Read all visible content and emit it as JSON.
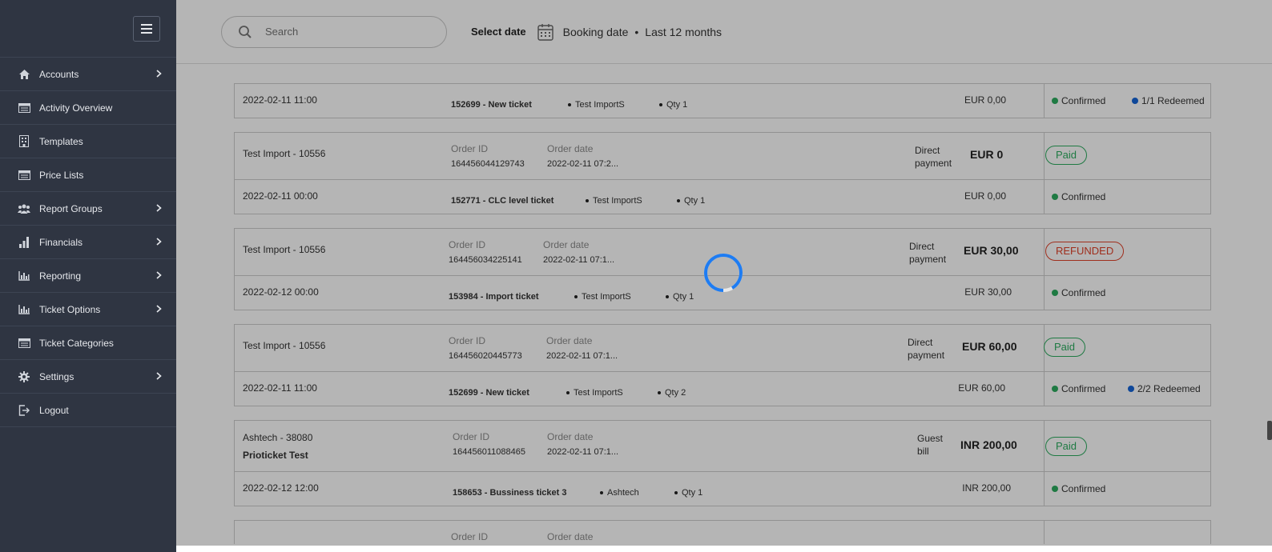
{
  "sidebar": {
    "items": [
      {
        "label": "Accounts",
        "icon": "home-icon",
        "has_submenu": true
      },
      {
        "label": "Activity Overview",
        "icon": "list-card-icon",
        "has_submenu": false
      },
      {
        "label": "Templates",
        "icon": "building-icon",
        "has_submenu": false
      },
      {
        "label": "Price Lists",
        "icon": "list-card-icon",
        "has_submenu": false
      },
      {
        "label": "Report Groups",
        "icon": "users-icon",
        "has_submenu": true
      },
      {
        "label": "Financials",
        "icon": "bar-chart-icon",
        "has_submenu": true
      },
      {
        "label": "Reporting",
        "icon": "chart-icon",
        "has_submenu": true
      },
      {
        "label": "Ticket Options",
        "icon": "chart-icon",
        "has_submenu": true
      },
      {
        "label": "Ticket Categories",
        "icon": "list-card-icon",
        "has_submenu": false
      },
      {
        "label": "Settings",
        "icon": "gear-icon",
        "has_submenu": true
      },
      {
        "label": "Logout",
        "icon": "logout-icon",
        "has_submenu": false
      }
    ]
  },
  "header": {
    "search_placeholder": "Search",
    "select_date_label": "Select date",
    "date_type": "Booking date",
    "date_range": "Last 12 months",
    "separator": "•"
  },
  "labels": {
    "order_id": "Order ID",
    "order_date": "Order date"
  },
  "orders": [
    {
      "partial": true,
      "bottom": {
        "datetime": "2022-02-11 11:00",
        "product": "152699 - New ticket",
        "supplier": "Test ImportS",
        "qty": "Qty 1",
        "line_amount": "EUR 0,00",
        "status": "Confirmed",
        "redeemed": "1/1 Redeemed"
      }
    },
    {
      "top": {
        "name": "Test Import - 10556",
        "subname": "",
        "order_id": "164456044129743",
        "order_date": "2022-02-11 07:2...",
        "payment": [
          "Direct",
          "payment"
        ],
        "amount": "EUR 0",
        "badge": "Paid",
        "badge_type": "paid"
      },
      "bottom": {
        "datetime": "2022-02-11 00:00",
        "product": "152771 - CLC level ticket",
        "supplier": "Test ImportS",
        "qty": "Qty 1",
        "line_amount": "EUR 0,00",
        "status": "Confirmed",
        "redeemed": ""
      }
    },
    {
      "top": {
        "name": "Test Import - 10556",
        "subname": "",
        "order_id": "164456034225141",
        "order_date": "2022-02-11 07:1...",
        "payment": [
          "Direct",
          "payment"
        ],
        "amount": "EUR 30,00",
        "badge": "REFUNDED",
        "badge_type": "refunded"
      },
      "bottom": {
        "datetime": "2022-02-12 00:00",
        "product": "153984 - Import ticket",
        "supplier": "Test ImportS",
        "qty": "Qty 1",
        "line_amount": "EUR 30,00",
        "status": "Confirmed",
        "redeemed": ""
      }
    },
    {
      "top": {
        "name": "Test Import - 10556",
        "subname": "",
        "order_id": "164456020445773",
        "order_date": "2022-02-11 07:1...",
        "payment": [
          "Direct",
          "payment"
        ],
        "amount": "EUR 60,00",
        "badge": "Paid",
        "badge_type": "paid"
      },
      "bottom": {
        "datetime": "2022-02-11 11:00",
        "product": "152699 - New ticket",
        "supplier": "Test ImportS",
        "qty": "Qty 2",
        "line_amount": "EUR 60,00",
        "status": "Confirmed",
        "redeemed": "2/2 Redeemed"
      }
    },
    {
      "top": {
        "name": "Ashtech - 38080",
        "subname": "Prioticket Test",
        "order_id": "164456011088465",
        "order_date": "2022-02-11 07:1...",
        "payment": [
          "Guest",
          "bill"
        ],
        "amount": "INR 200,00",
        "badge": "Paid",
        "badge_type": "paid"
      },
      "bottom": {
        "datetime": "2022-02-12 12:00",
        "product": "158653 - Bussiness ticket 3",
        "supplier": "Ashtech",
        "qty": "Qty 1",
        "line_amount": "INR 200,00",
        "status": "Confirmed",
        "redeemed": ""
      }
    }
  ],
  "colors": {
    "sidebar_bg": "#2f3542",
    "paid": "#2dac5f",
    "refunded": "#e0422a",
    "redeemed_dot": "#1565d8",
    "spinner": "#1e7cf2"
  }
}
